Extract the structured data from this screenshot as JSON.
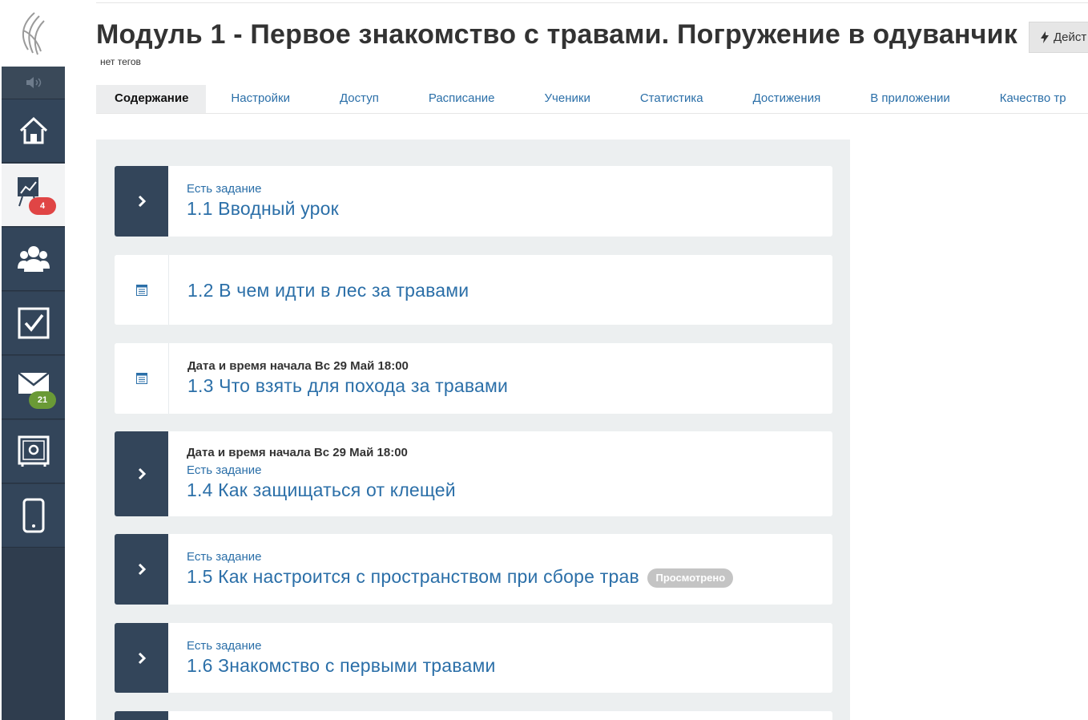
{
  "header": {
    "title": "Модуль 1 - Первое знакомство с травами. Погружение в одуванчик",
    "tags": "нет тегов",
    "action_label": "Дейст"
  },
  "tabs": [
    {
      "label": "Содержание",
      "active": true
    },
    {
      "label": "Настройки"
    },
    {
      "label": "Доступ"
    },
    {
      "label": "Расписание"
    },
    {
      "label": "Ученики"
    },
    {
      "label": "Статистика"
    },
    {
      "label": "Достижения"
    },
    {
      "label": "В приложении"
    },
    {
      "label": "Качество тр"
    }
  ],
  "sidebar": {
    "items": [
      {
        "icon": "home-icon"
      },
      {
        "icon": "chart-icon",
        "badge": "4",
        "active": true
      },
      {
        "icon": "users-icon"
      },
      {
        "icon": "tasks-icon"
      },
      {
        "icon": "mail-icon",
        "badge": "21"
      },
      {
        "icon": "safe-icon"
      },
      {
        "icon": "mobile-icon"
      }
    ]
  },
  "lessons": [
    {
      "task": "Есть задание",
      "title": "1.1 Вводный урок"
    },
    {
      "title": "1.2 В чем идти в лес за травами"
    },
    {
      "date": "Дата и время начала Вс 29 Май 18:00",
      "title": "1.3 Что взять для похода за травами"
    },
    {
      "date": "Дата и время начала Вс 29 Май 18:00",
      "task": "Есть задание",
      "title": "1.4 Как защищаться от клещей"
    },
    {
      "task": "Есть задание",
      "title": "1.5 Как настроится с пространством при сборе трав",
      "status": "Просмотрено"
    },
    {
      "task": "Есть задание",
      "title": "1.6 Знакомство с первыми травами"
    }
  ],
  "colors": {
    "sidebar": "#2f3d4e",
    "link": "#2b6fa8",
    "badge_red": "#e04545",
    "badge_green": "#6a9a36"
  }
}
